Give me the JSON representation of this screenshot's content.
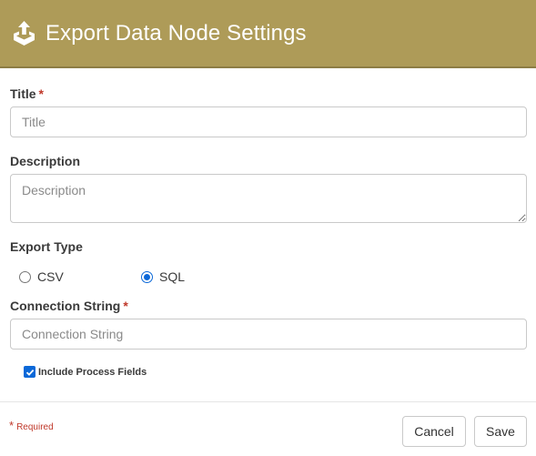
{
  "dialog": {
    "title": "Export Data Node Settings",
    "icon": "export-upload-icon"
  },
  "form": {
    "title_label": "Title",
    "title_placeholder": "Title",
    "title_value": "",
    "description_label": "Description",
    "description_placeholder": "Description",
    "description_value": "",
    "export_type_label": "Export Type",
    "export_type_options": [
      {
        "label": "CSV",
        "selected": false
      },
      {
        "label": "SQL",
        "selected": true
      }
    ],
    "connection_label": "Connection String",
    "connection_placeholder": "Connection String",
    "connection_value": "",
    "include_process_fields_label": "Include Process Fields",
    "include_process_fields_checked": true,
    "required_mark": "*"
  },
  "footer": {
    "required_note": "Required",
    "cancel_label": "Cancel",
    "save_label": "Save"
  },
  "colors": {
    "header_bg": "#ae9b58",
    "required": "#c0392b",
    "accent": "#0b68d8"
  }
}
